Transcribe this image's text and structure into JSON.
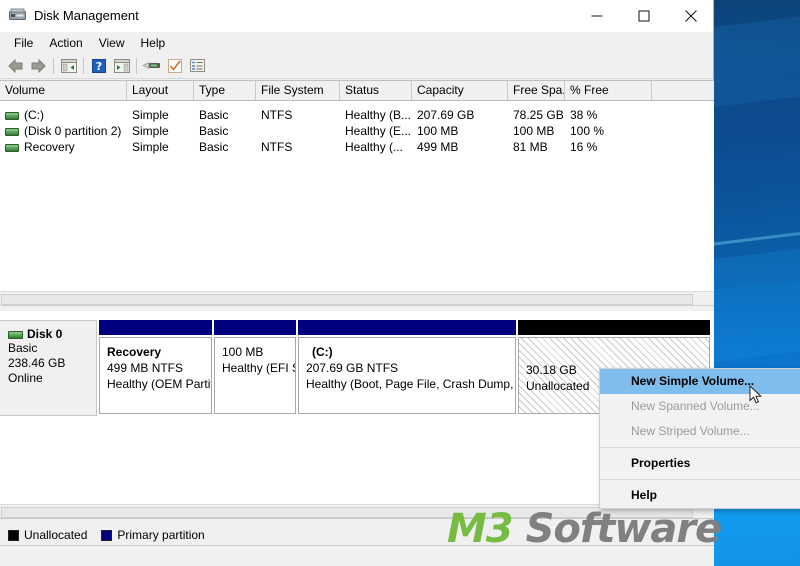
{
  "window": {
    "title": "Disk Management",
    "app_icon": "disk-management-icon",
    "controls": {
      "minimize": "minimize",
      "maximize": "maximize",
      "close": "close"
    }
  },
  "menubar": {
    "items": [
      "File",
      "Action",
      "View",
      "Help"
    ]
  },
  "toolbar": {
    "buttons": [
      "back-arrow-icon",
      "forward-arrow-icon",
      "show-hide-console-tree-icon",
      "help-icon",
      "show-hide-action-pane-icon",
      "properties-icon",
      "rescan-disks-icon",
      "list-view-icon"
    ]
  },
  "volume_list": {
    "columns": [
      "Volume",
      "Layout",
      "Type",
      "File System",
      "Status",
      "Capacity",
      "Free Spa...",
      "% Free",
      ""
    ],
    "rows": [
      {
        "volume": "(C:)",
        "layout": "Simple",
        "type": "Basic",
        "file_system": "NTFS",
        "status": "Healthy (B...",
        "capacity": "207.69 GB",
        "free_space": "78.25 GB",
        "percent_free": "38 %"
      },
      {
        "volume": "(Disk 0 partition 2)",
        "layout": "Simple",
        "type": "Basic",
        "file_system": "",
        "status": "Healthy (E...",
        "capacity": "100 MB",
        "free_space": "100 MB",
        "percent_free": "100 %"
      },
      {
        "volume": "Recovery",
        "layout": "Simple",
        "type": "Basic",
        "file_system": "NTFS",
        "status": "Healthy (...",
        "capacity": "499 MB",
        "free_space": "81 MB",
        "percent_free": "16 %"
      }
    ]
  },
  "disk_graphic": {
    "disk": {
      "name": "Disk 0",
      "type": "Basic",
      "size": "238.46 GB",
      "status": "Online"
    },
    "partitions": [
      {
        "name": "Recovery",
        "size_fs": "499 MB NTFS",
        "status": "Healthy (OEM Partit",
        "cap_color": "#000080"
      },
      {
        "name": "",
        "size_fs": "100 MB",
        "status": "Healthy (EFI S",
        "cap_color": "#000080"
      },
      {
        "name": "(C:)",
        "size_fs": "207.69 GB NTFS",
        "status": "Healthy (Boot, Page File, Crash Dump, Pri",
        "cap_color": "#000080"
      },
      {
        "name": "",
        "size_fs": "30.18 GB",
        "status": "Unallocated",
        "cap_color": "#000000"
      }
    ]
  },
  "legend": {
    "items": [
      {
        "label": "Unallocated",
        "color": "#000000"
      },
      {
        "label": "Primary partition",
        "color": "#000080"
      }
    ]
  },
  "context_menu": {
    "items": [
      {
        "label": "New Simple Volume...",
        "state": "selected"
      },
      {
        "label": "New Spanned Volume...",
        "state": "disabled"
      },
      {
        "label": "New Striped Volume...",
        "state": "disabled"
      },
      {
        "label": "separator",
        "state": "separator"
      },
      {
        "label": "Properties",
        "state": "bold"
      },
      {
        "label": "separator",
        "state": "separator"
      },
      {
        "label": "Help",
        "state": "bold"
      }
    ]
  },
  "watermark": {
    "part1": "M3",
    "part2": "Software",
    "color1": "#76bc43",
    "color2": "#808080"
  }
}
